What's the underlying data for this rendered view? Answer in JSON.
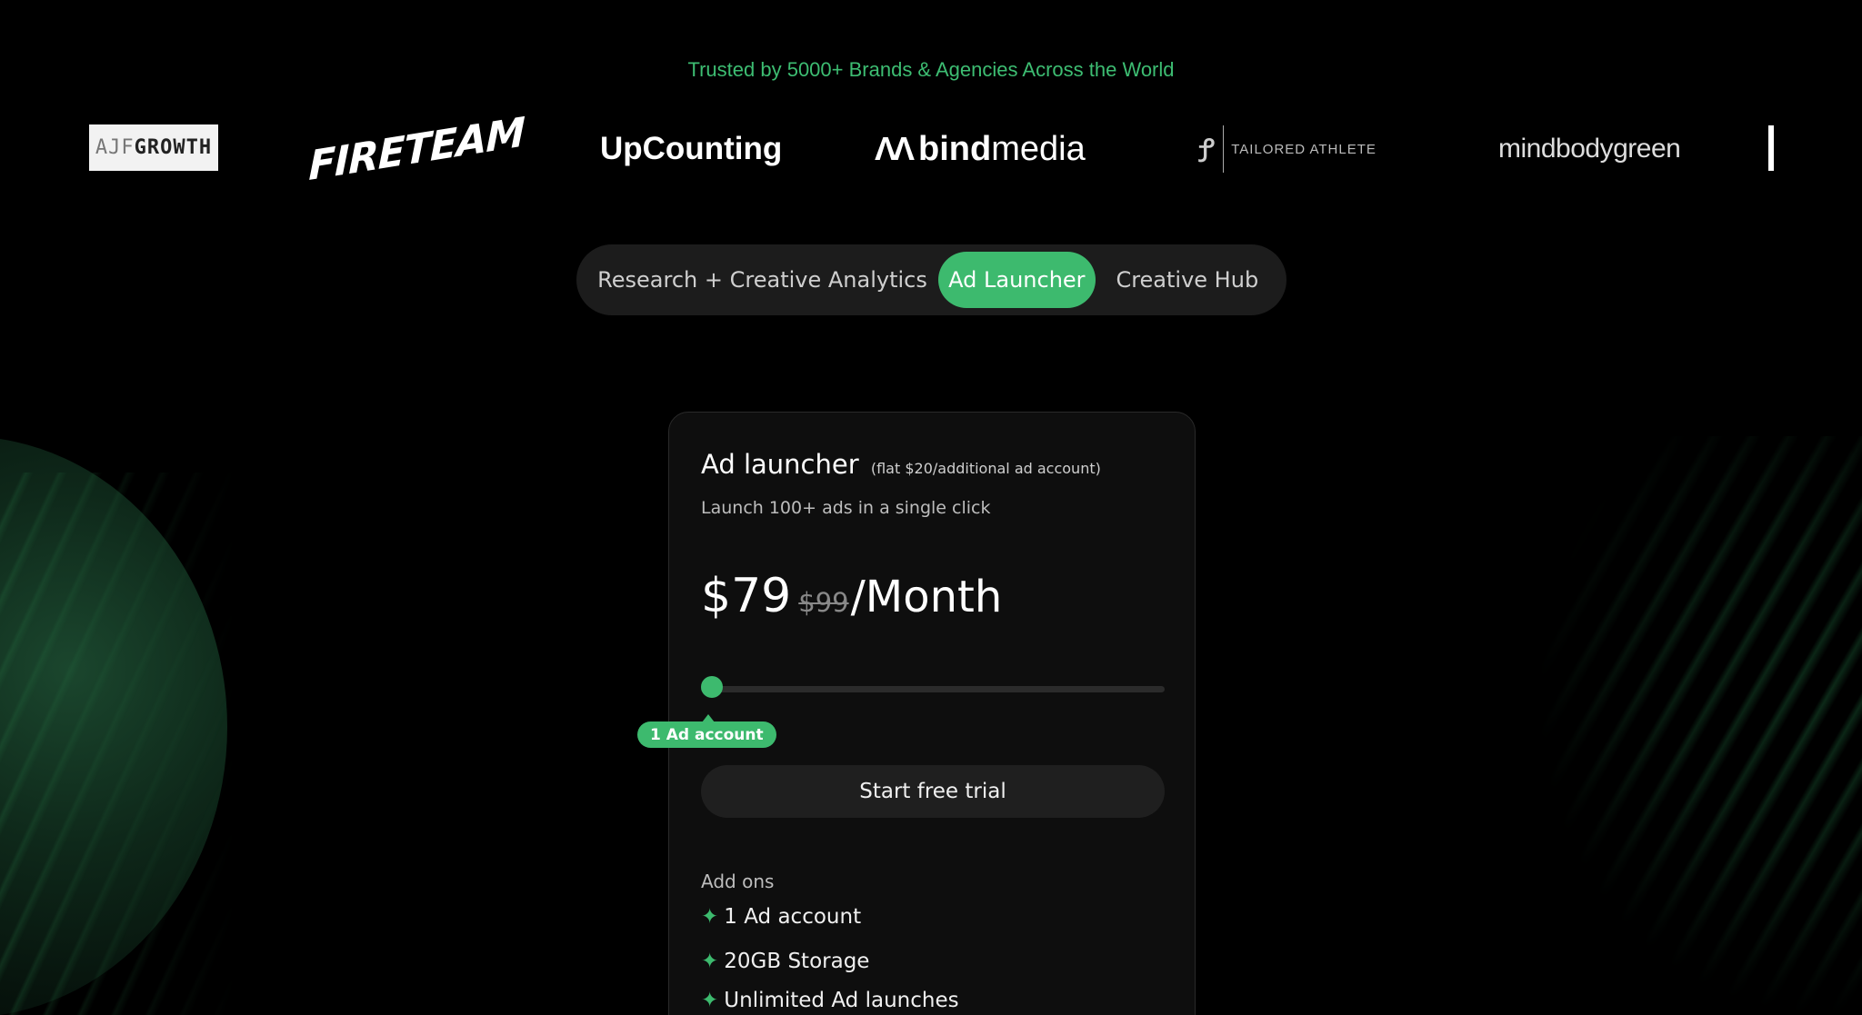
{
  "header": {
    "tagline": "Trusted by 5000+ Brands & Agencies Across the World"
  },
  "logos": {
    "ajf_prefix": "AJF",
    "ajf_suffix": "GROWTH",
    "fireteam": "FIRETEAM",
    "upcounting": "UpCounting",
    "bindmedia_bold": "bind",
    "bindmedia_light": "media",
    "tailored": "TAILORED ATHLETE",
    "mindbodygreen": "mindbodygreen"
  },
  "tabs": [
    {
      "label": "Research + Creative Analytics",
      "active": false
    },
    {
      "label": "Ad Launcher",
      "active": true
    },
    {
      "label": "Creative Hub",
      "active": false
    }
  ],
  "card": {
    "title": "Ad launcher",
    "title_note": "(flat $20/additional ad account)",
    "subtitle": "Launch 100+ ads in a single click",
    "price": "$79",
    "old_price": "$99",
    "period": "/Month",
    "slider": {
      "value_label": "1 Ad account"
    },
    "cta_label": "Start free trial",
    "addons_label": "Add ons",
    "addons": [
      "1 Ad account",
      "20GB Storage",
      "Unlimited Ad launches"
    ]
  },
  "colors": {
    "accent": "#3dba6e",
    "background": "#000000",
    "card": "#0e0e0e"
  }
}
